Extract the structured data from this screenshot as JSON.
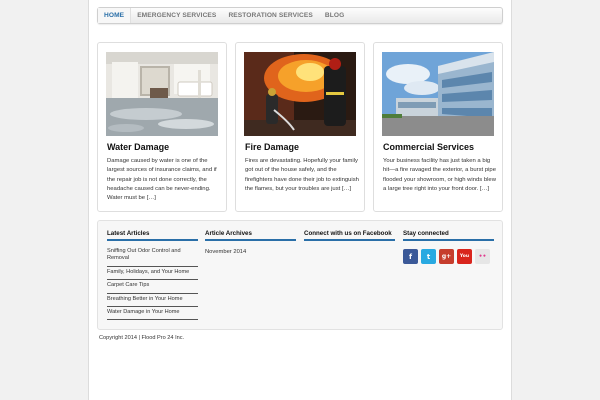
{
  "nav": {
    "items": [
      {
        "label": "HOME",
        "active": true
      },
      {
        "label": "EMERGENCY SERVICES",
        "active": false
      },
      {
        "label": "RESTORATION SERVICES",
        "active": false
      },
      {
        "label": "BLOG",
        "active": false
      }
    ]
  },
  "cards": [
    {
      "title": "Water Damage",
      "text": "Damage caused by water is one of the largest sources of insurance claims, and if the repair job is not done correctly, the headache caused can be never-ending. Water must be […]"
    },
    {
      "title": "Fire Damage",
      "text": "Fires are devastating. Hopefully your family got out of the house safely, and the firefighters have done their job to extinguish the flames, but your troubles are just […]"
    },
    {
      "title": "Commercial Services",
      "text": "Your business facility has just taken a big hit—a fire ravaged the exterior, a burst pipe flooded your showroom, or high winds blew a large tree right into your front door. […]"
    }
  ],
  "widgets": {
    "latest": {
      "title": "Latest Articles",
      "items": [
        "Sniffing Out Odor Control and Removal",
        "Family, Holidays, and Your Home",
        "Carpet Care Tips",
        "Breathing Better in Your Home",
        "Water Damage in Your Home"
      ]
    },
    "archives": {
      "title": "Article Archives",
      "items": [
        "November 2014"
      ]
    },
    "facebook": {
      "title": "Connect with us on Facebook"
    },
    "social": {
      "title": "Stay connected",
      "icons": [
        {
          "name": "facebook-icon",
          "glyph": "f",
          "color": "#3b5998"
        },
        {
          "name": "twitter-icon",
          "glyph": "t",
          "color": "#29a9e1"
        },
        {
          "name": "google-plus-icon",
          "glyph": "g+",
          "color": "#c63d2d"
        },
        {
          "name": "youtube-icon",
          "glyph": "You",
          "color": "#d9251d"
        },
        {
          "name": "flickr-icon",
          "glyph": "••",
          "color": "#e6e6e6"
        }
      ]
    }
  },
  "footer": {
    "copyright": "Copyright 2014 | Flood Pro 24 Inc."
  }
}
